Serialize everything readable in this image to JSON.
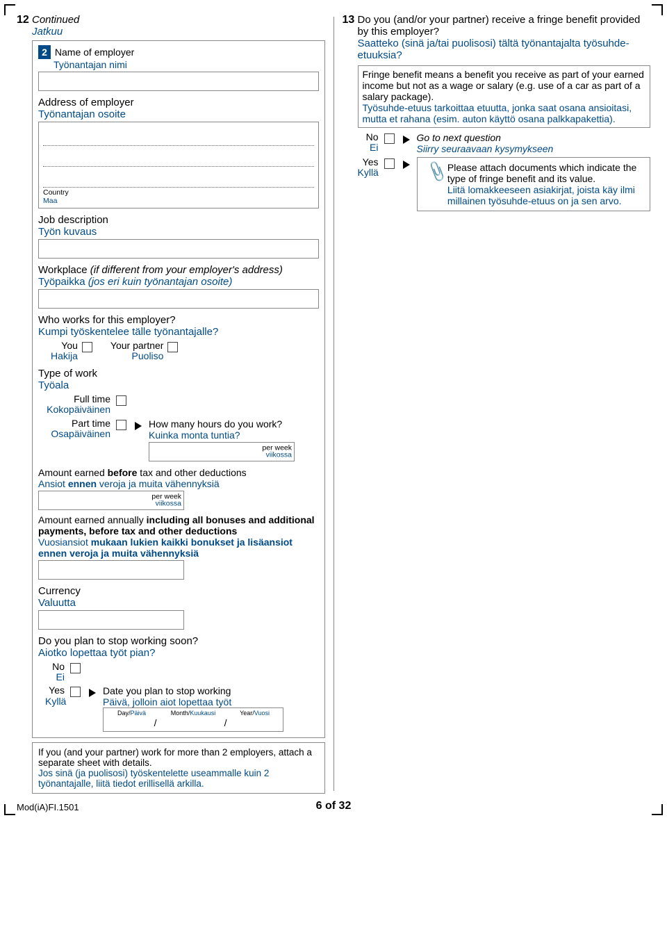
{
  "q12": {
    "number": "12",
    "continued_en": "Continued",
    "continued_fi": "Jatkuu",
    "badge": "2",
    "employer_name_en": "Name of employer",
    "employer_name_fi": "Työnantajan nimi",
    "employer_address_en": "Address of employer",
    "employer_address_fi": "Työnantajan osoite",
    "country_en": "Country",
    "country_fi": "Maa",
    "job_desc_en": "Job description",
    "job_desc_fi": "Työn kuvaus",
    "workplace_en_pre": "Workplace ",
    "workplace_en_it": "(if different from your employer's address)",
    "workplace_fi_pre": "Työpaikka ",
    "workplace_fi_it": "(jos eri kuin työnantajan osoite)",
    "who_works_en": "Who works for this employer?",
    "who_works_fi": "Kumpi työskentelee tälle työnantajalle?",
    "you_en": "You",
    "you_fi": "Hakija",
    "partner_en": "Your partner",
    "partner_fi": "Puoliso",
    "type_en": "Type of work",
    "type_fi": "Työala",
    "fulltime_en": "Full time",
    "fulltime_fi": "Kokopäiväinen",
    "parttime_en": "Part time",
    "parttime_fi": "Osapäiväinen",
    "hours_en": "How many hours do you work?",
    "hours_fi": "Kuinka monta tuntia?",
    "perweek_en": "per week",
    "perweek_fi": "viikossa",
    "amount_before_en_a": "Amount earned ",
    "amount_before_en_b": "before",
    "amount_before_en_c": " tax and other deductions",
    "amount_before_fi_a": "Ansiot ",
    "amount_before_fi_b": "ennen",
    "amount_before_fi_c": " veroja ja muita vähennyksiä",
    "amount_annual_en_a": "Amount earned annually ",
    "amount_annual_en_b": "including all bonuses and additional payments, before tax and other deductions",
    "amount_annual_fi_a": "Vuosiansiot ",
    "amount_annual_fi_b": "mukaan lukien kaikki bonukset ja lisäansiot ennen veroja ja muita vähennyksiä",
    "currency_en": "Currency",
    "currency_fi": "Valuutta",
    "stop_en": "Do you plan to stop working soon?",
    "stop_fi": "Aiotko lopettaa työt pian?",
    "no_en": "No",
    "no_fi": "Ei",
    "yes_en": "Yes",
    "yes_fi": "Kyllä",
    "date_stop_en": "Date you plan to stop working",
    "date_stop_fi": "Päivä, jolloin aiot lopettaa työt",
    "day_en": "Day",
    "day_fi": "Päivä",
    "month_en": "Month",
    "month_fi": "Kuukausi",
    "year_en": "Year",
    "year_fi": "Vuosi",
    "slash": "/",
    "note_en": "If you (and your partner) work for more than 2 employers, attach a separate sheet with details.",
    "note_fi": "Jos sinä (ja puolisosi) työskentelette useammalle kuin 2 työnantajalle, liitä tiedot erillisellä arkilla."
  },
  "q13": {
    "number": "13",
    "question_en": "Do you (and/or your partner) receive a fringe benefit provided by this employer?",
    "question_fi": "Saatteko (sinä ja/tai puolisosi) tältä työnantajalta työsuhde-etuuksia?",
    "fringe_en": "Fringe benefit means a benefit you receive as part of your earned income but not as a wage or salary (e.g. use of a car as part of a salary package).",
    "fringe_fi": "Työsuhde-etuus tarkoittaa etuutta, jonka saat osana ansioitasi, mutta et rahana (esim. auton käyttö osana palkkapakettia).",
    "no_en": "No",
    "no_fi": "Ei",
    "yes_en": "Yes",
    "yes_fi": "Kyllä",
    "goto_en": "Go to next question",
    "goto_fi": "Siirry seuraavaan kysymykseen",
    "attach_en": "Please attach documents which indicate the type of fringe benefit and its value.",
    "attach_fi": "Liitä lomakkeeseen asiakirjat, joista käy ilmi millainen työsuhde-etuus on ja sen arvo."
  },
  "footer": {
    "code": "Mod(iA)FI.1501",
    "page": "6 of 32"
  }
}
